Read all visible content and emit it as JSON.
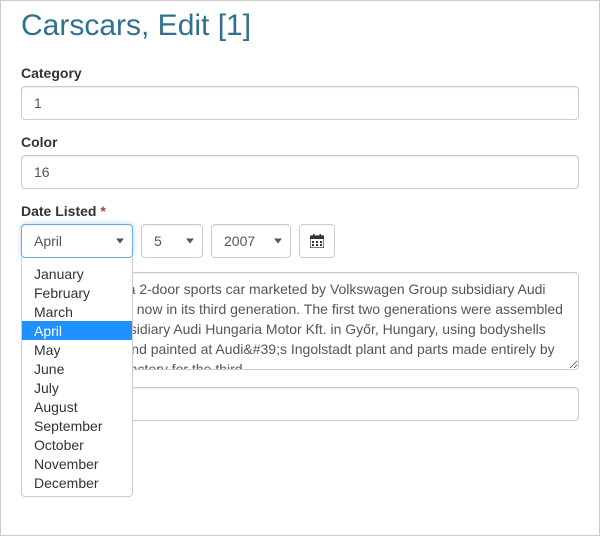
{
  "page": {
    "title": "Carscars, Edit [1]"
  },
  "form": {
    "category": {
      "label": "Category",
      "value": "1"
    },
    "color": {
      "label": "Color",
      "value": "16"
    },
    "date_listed": {
      "label": "Date Listed",
      "required_marker": "*",
      "month": "April",
      "day": "5",
      "year": "2007",
      "months": [
        "January",
        "February",
        "March",
        "April",
        "May",
        "June",
        "July",
        "August",
        "September",
        "October",
        "November",
        "December"
      ]
    },
    "description": {
      "value": "The Audi TT is a 2-door sports car marketed by Volkswagen Group subsidiary Audi since 1998, and now in its third generation. The first two generations were assembled by the Audi subsidiary Audi Hungaria Motor Kft. in Győr, Hungary, using bodyshells manufactured and painted at Audi&#39;s Ingolstadt plant and parts made entirely by the Hungarian factory for the third"
    }
  },
  "icons": {
    "calendar": "calendar-icon"
  }
}
